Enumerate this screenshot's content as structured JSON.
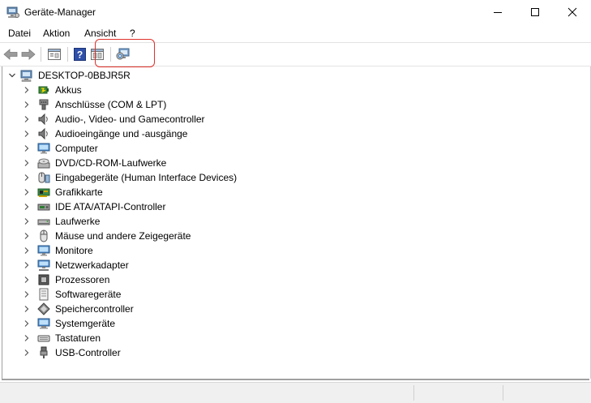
{
  "window": {
    "title": "Geräte-Manager",
    "controls": [
      "minimize",
      "maximize",
      "close"
    ]
  },
  "menu": {
    "items": [
      "Datei",
      "Aktion",
      "Ansicht",
      "?"
    ]
  },
  "toolbar": {
    "buttons": [
      "back-arrow-icon",
      "forward-arrow-icon",
      "properties-icon",
      "help-icon",
      "show-hidden-icon",
      "scan-hardware-icon"
    ],
    "highlight_color": "#e0312b"
  },
  "tree": {
    "root": "DESKTOP-0BBJR5R",
    "items": [
      {
        "label": "Akkus",
        "icon": "battery-icon"
      },
      {
        "label": "Anschlüsse (COM & LPT)",
        "icon": "port-icon"
      },
      {
        "label": "Audio-, Video- und Gamecontroller",
        "icon": "speaker-icon"
      },
      {
        "label": "Audioeingänge und -ausgänge",
        "icon": "speaker-icon"
      },
      {
        "label": "Computer",
        "icon": "monitor-icon"
      },
      {
        "label": "DVD/CD-ROM-Laufwerke",
        "icon": "disc-drive-icon"
      },
      {
        "label": "Eingabegeräte (Human Interface Devices)",
        "icon": "hid-icon"
      },
      {
        "label": "Grafikkarte",
        "icon": "graphics-card-icon"
      },
      {
        "label": "IDE ATA/ATAPI-Controller",
        "icon": "ide-controller-icon"
      },
      {
        "label": "Laufwerke",
        "icon": "drive-icon"
      },
      {
        "label": "Mäuse und andere Zeigegeräte",
        "icon": "mouse-icon"
      },
      {
        "label": "Monitore",
        "icon": "monitor-icon"
      },
      {
        "label": "Netzwerkadapter",
        "icon": "network-adapter-icon"
      },
      {
        "label": "Prozessoren",
        "icon": "processor-icon"
      },
      {
        "label": "Softwaregeräte",
        "icon": "software-device-icon"
      },
      {
        "label": "Speichercontroller",
        "icon": "storage-controller-icon"
      },
      {
        "label": "Systemgeräte",
        "icon": "system-device-icon"
      },
      {
        "label": "Tastaturen",
        "icon": "keyboard-icon"
      },
      {
        "label": "USB-Controller",
        "icon": "usb-icon"
      }
    ]
  }
}
